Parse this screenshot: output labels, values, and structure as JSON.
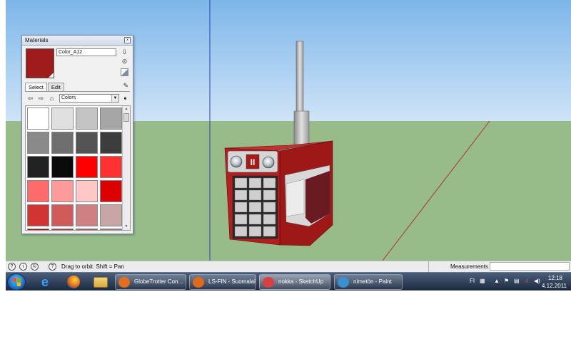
{
  "materials_panel": {
    "title": "Materials",
    "close_glyph": "×",
    "material_name": "Color_A12",
    "current_color": "#a01c1c",
    "tabs": [
      "Select",
      "Edit"
    ],
    "library": "Colors",
    "swatches": [
      "#ffffff",
      "#e0e0e0",
      "#c4c4c4",
      "#a6a6a6",
      "#8a8a8a",
      "#6e6e6e",
      "#545454",
      "#3c3c3c",
      "#222222",
      "#0a0a0a",
      "#ff0000",
      "#ff3030",
      "#ff6a6a",
      "#ff9a9a",
      "#ffc8c8",
      "#dd0000",
      "#d23434",
      "#d05a5a",
      "#cf8080",
      "#c8a6a6",
      "#b00000",
      "#b03030",
      "#a85252",
      "#a27070"
    ]
  },
  "status_bar": {
    "hint": "Drag to orbit.  Shift = Pan",
    "measurements_label": "Measurements"
  },
  "taskbar": {
    "buttons": [
      {
        "label": "GlobeTrotter Con...",
        "icon": "globetrotter-icon",
        "color": "#e07020"
      },
      {
        "label": "LS-FIN - Suomalai...",
        "icon": "firefox-icon",
        "color": "#e06a1a"
      },
      {
        "label": "nokka - SketchUp",
        "icon": "sketchup-icon",
        "color": "#d94040",
        "active": true
      },
      {
        "label": "nimetön - Paint",
        "icon": "paint-icon",
        "color": "#3a8fd0"
      }
    ],
    "language": "FI",
    "time": "12:18",
    "date": "4.12.2011"
  },
  "colors": {
    "sky": "#a9cff0",
    "ground": "#97bc8a",
    "model_red": "#b41e1e"
  }
}
